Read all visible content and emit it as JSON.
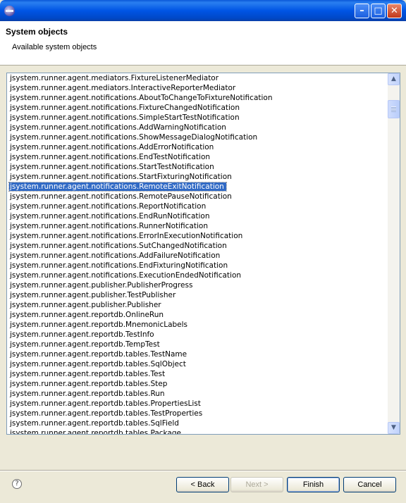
{
  "window": {
    "title": "",
    "controls": {
      "minimize": "minimize-icon",
      "maximize": "maximize-icon",
      "close": "close-icon"
    }
  },
  "header": {
    "title": "System objects",
    "description": "Available system objects"
  },
  "list": {
    "selected_index": 11,
    "items": [
      "jsystem.runner.agent.mediators.FixtureListenerMediator",
      "jsystem.runner.agent.mediators.InteractiveReporterMediator",
      "jsystem.runner.agent.notifications.AboutToChangeToFixtureNotification",
      "jsystem.runner.agent.notifications.FixtureChangedNotification",
      "jsystem.runner.agent.notifications.SimpleStartTestNotification",
      "jsystem.runner.agent.notifications.AddWarningNotification",
      "jsystem.runner.agent.notifications.ShowMessageDialogNotification",
      "jsystem.runner.agent.notifications.AddErrorNotification",
      "jsystem.runner.agent.notifications.EndTestNotification",
      "jsystem.runner.agent.notifications.StartTestNotification",
      "jsystem.runner.agent.notifications.StartFixturingNotification",
      "jsystem.runner.agent.notifications.RemoteExitNotification",
      "jsystem.runner.agent.notifications.RemotePauseNotification",
      "jsystem.runner.agent.notifications.ReportNotification",
      "jsystem.runner.agent.notifications.EndRunNotification",
      "jsystem.runner.agent.notifications.RunnerNotification",
      "jsystem.runner.agent.notifications.ErrorInExecutionNotification",
      "jsystem.runner.agent.notifications.SutChangedNotification",
      "jsystem.runner.agent.notifications.AddFailureNotification",
      "jsystem.runner.agent.notifications.EndFixturingNotification",
      "jsystem.runner.agent.notifications.ExecutionEndedNotification",
      "jsystem.runner.agent.publisher.PublisherProgress",
      "jsystem.runner.agent.publisher.TestPublisher",
      "jsystem.runner.agent.publisher.Publisher",
      "jsystem.runner.agent.reportdb.OnlineRun",
      "jsystem.runner.agent.reportdb.MnemonicLabels",
      "jsystem.runner.agent.reportdb.TestInfo",
      "jsystem.runner.agent.reportdb.TempTest",
      "jsystem.runner.agent.reportdb.tables.TestName",
      "jsystem.runner.agent.reportdb.tables.SqlObject",
      "jsystem.runner.agent.reportdb.tables.Test",
      "jsystem.runner.agent.reportdb.tables.Step",
      "jsystem.runner.agent.reportdb.tables.Run",
      "jsystem.runner.agent.reportdb.tables.PropertiesList",
      "jsystem.runner.agent.reportdb.tables.TestProperties",
      "jsystem.runner.agent.reportdb.tables.SqlField",
      "jsystem.runner.agent.reportdb.tables.Package"
    ]
  },
  "footer": {
    "help_icon": "?",
    "back_label": "< Back",
    "next_label": "Next >",
    "finish_label": "Finish",
    "cancel_label": "Cancel"
  }
}
